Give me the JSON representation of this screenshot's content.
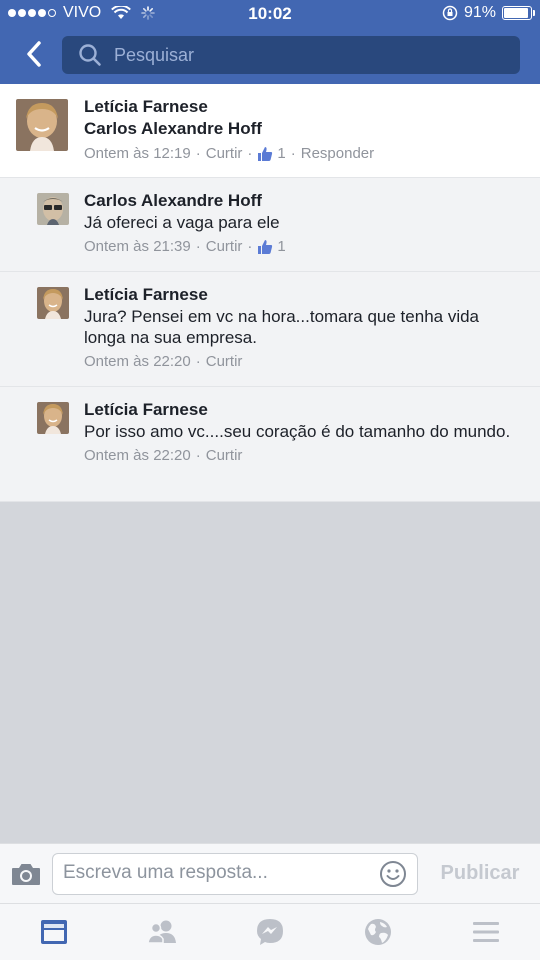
{
  "status_bar": {
    "carrier": "VIVO",
    "time": "10:02",
    "battery_percent": "91%",
    "signal_bars_filled": 4,
    "signal_bars_total": 5
  },
  "nav": {
    "back_icon": "chevron-left-icon",
    "search_placeholder": "Pesquisar"
  },
  "main_comment": {
    "author": "Letícia Farnese",
    "tagged": "Carlos Alexandre Hoff",
    "time": "Ontem às 12:19",
    "like_label": "Curtir",
    "like_count": "1",
    "reply_label": "Responder"
  },
  "replies": [
    {
      "author": "Carlos Alexandre Hoff",
      "text": "Já ofereci a vaga para ele",
      "time": "Ontem às 21:39",
      "like_label": "Curtir",
      "like_count": "1"
    },
    {
      "author": "Letícia Farnese",
      "text": "Jura? Pensei em vc na hora...tomara que tenha vida longa na sua empresa.",
      "time": "Ontem às 22:20",
      "like_label": "Curtir"
    },
    {
      "author": "Letícia Farnese",
      "text": "Por isso amo vc....seu coração é  do tamanho do mundo.",
      "time": "Ontem às 22:20",
      "like_label": "Curtir"
    }
  ],
  "composer": {
    "placeholder": "Escreva uma resposta...",
    "publish_label": "Publicar"
  },
  "tabs": [
    "news-feed-icon",
    "friends-icon",
    "messenger-icon",
    "globe-icon",
    "menu-icon"
  ],
  "colors": {
    "brand": "#4267b2",
    "search_bg": "#29487d",
    "meta_text": "#90949c",
    "tab_active": "#4267b2",
    "tab_inactive": "#bcc0c8"
  }
}
